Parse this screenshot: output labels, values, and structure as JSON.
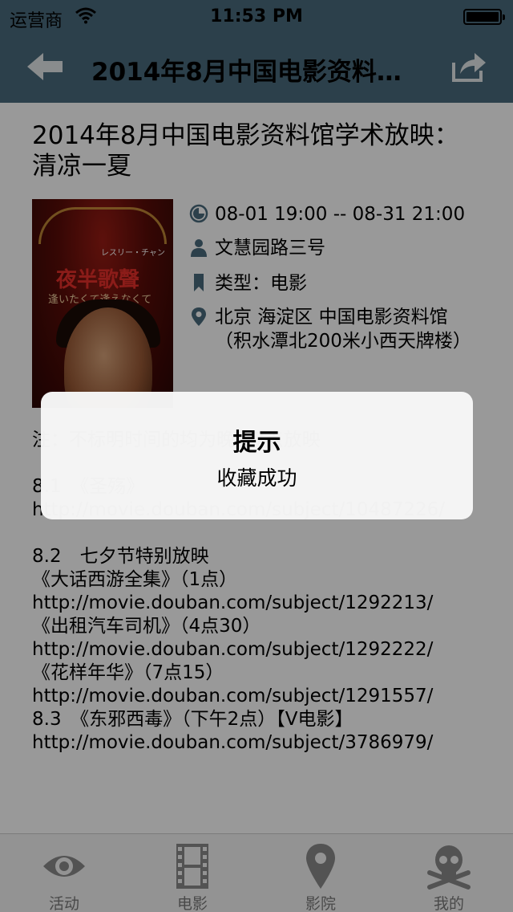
{
  "status_bar": {
    "carrier": "运营商",
    "time": "11:53 PM"
  },
  "nav": {
    "title": "2014年8月中国电影资料…"
  },
  "event": {
    "title": "2014年8月中国电影资料馆学术放映：清凉一夏",
    "time": "08-01 19:00 -- 08-31 21:00",
    "address": "文慧园路三号",
    "type": "类型：电影",
    "location": "北京 海淀区 中国电影资料馆（积水潭北200米小西天牌楼）",
    "body": "注：不标明时间的均为晚上7点放映\n\n8.1　《圣殇》\nhttp://movie.douban.com/subject/10487226/\n\n8.2　七夕节特别放映\n《大话西游全集》（1点）\nhttp://movie.douban.com/subject/1292213/\n《出租汽车司机》（4点30）\nhttp://movie.douban.com/subject/1292222/\n《花样年华》（7点15）\nhttp://movie.douban.com/subject/1291557/\n8.3　《东邪西毒》（下午2点）【V电影】\nhttp://movie.douban.com/subject/3786979/"
  },
  "poster": {
    "caption_small": "レスリー・チャン",
    "caption_big": "夜半歌聲",
    "caption_jp": "逢いたくて逢えなくて"
  },
  "tabs": [
    {
      "label": "活动",
      "icon": "eye-icon"
    },
    {
      "label": "电影",
      "icon": "film-icon"
    },
    {
      "label": "影院",
      "icon": "map-pin-icon"
    },
    {
      "label": "我的",
      "icon": "skull-icon"
    }
  ],
  "alert": {
    "title": "提示",
    "message": "收藏成功"
  },
  "colors": {
    "nav_bg": "#4a6c7d",
    "icon_accent": "#4a6c7d",
    "tab_icon": "#8a8a8a"
  }
}
